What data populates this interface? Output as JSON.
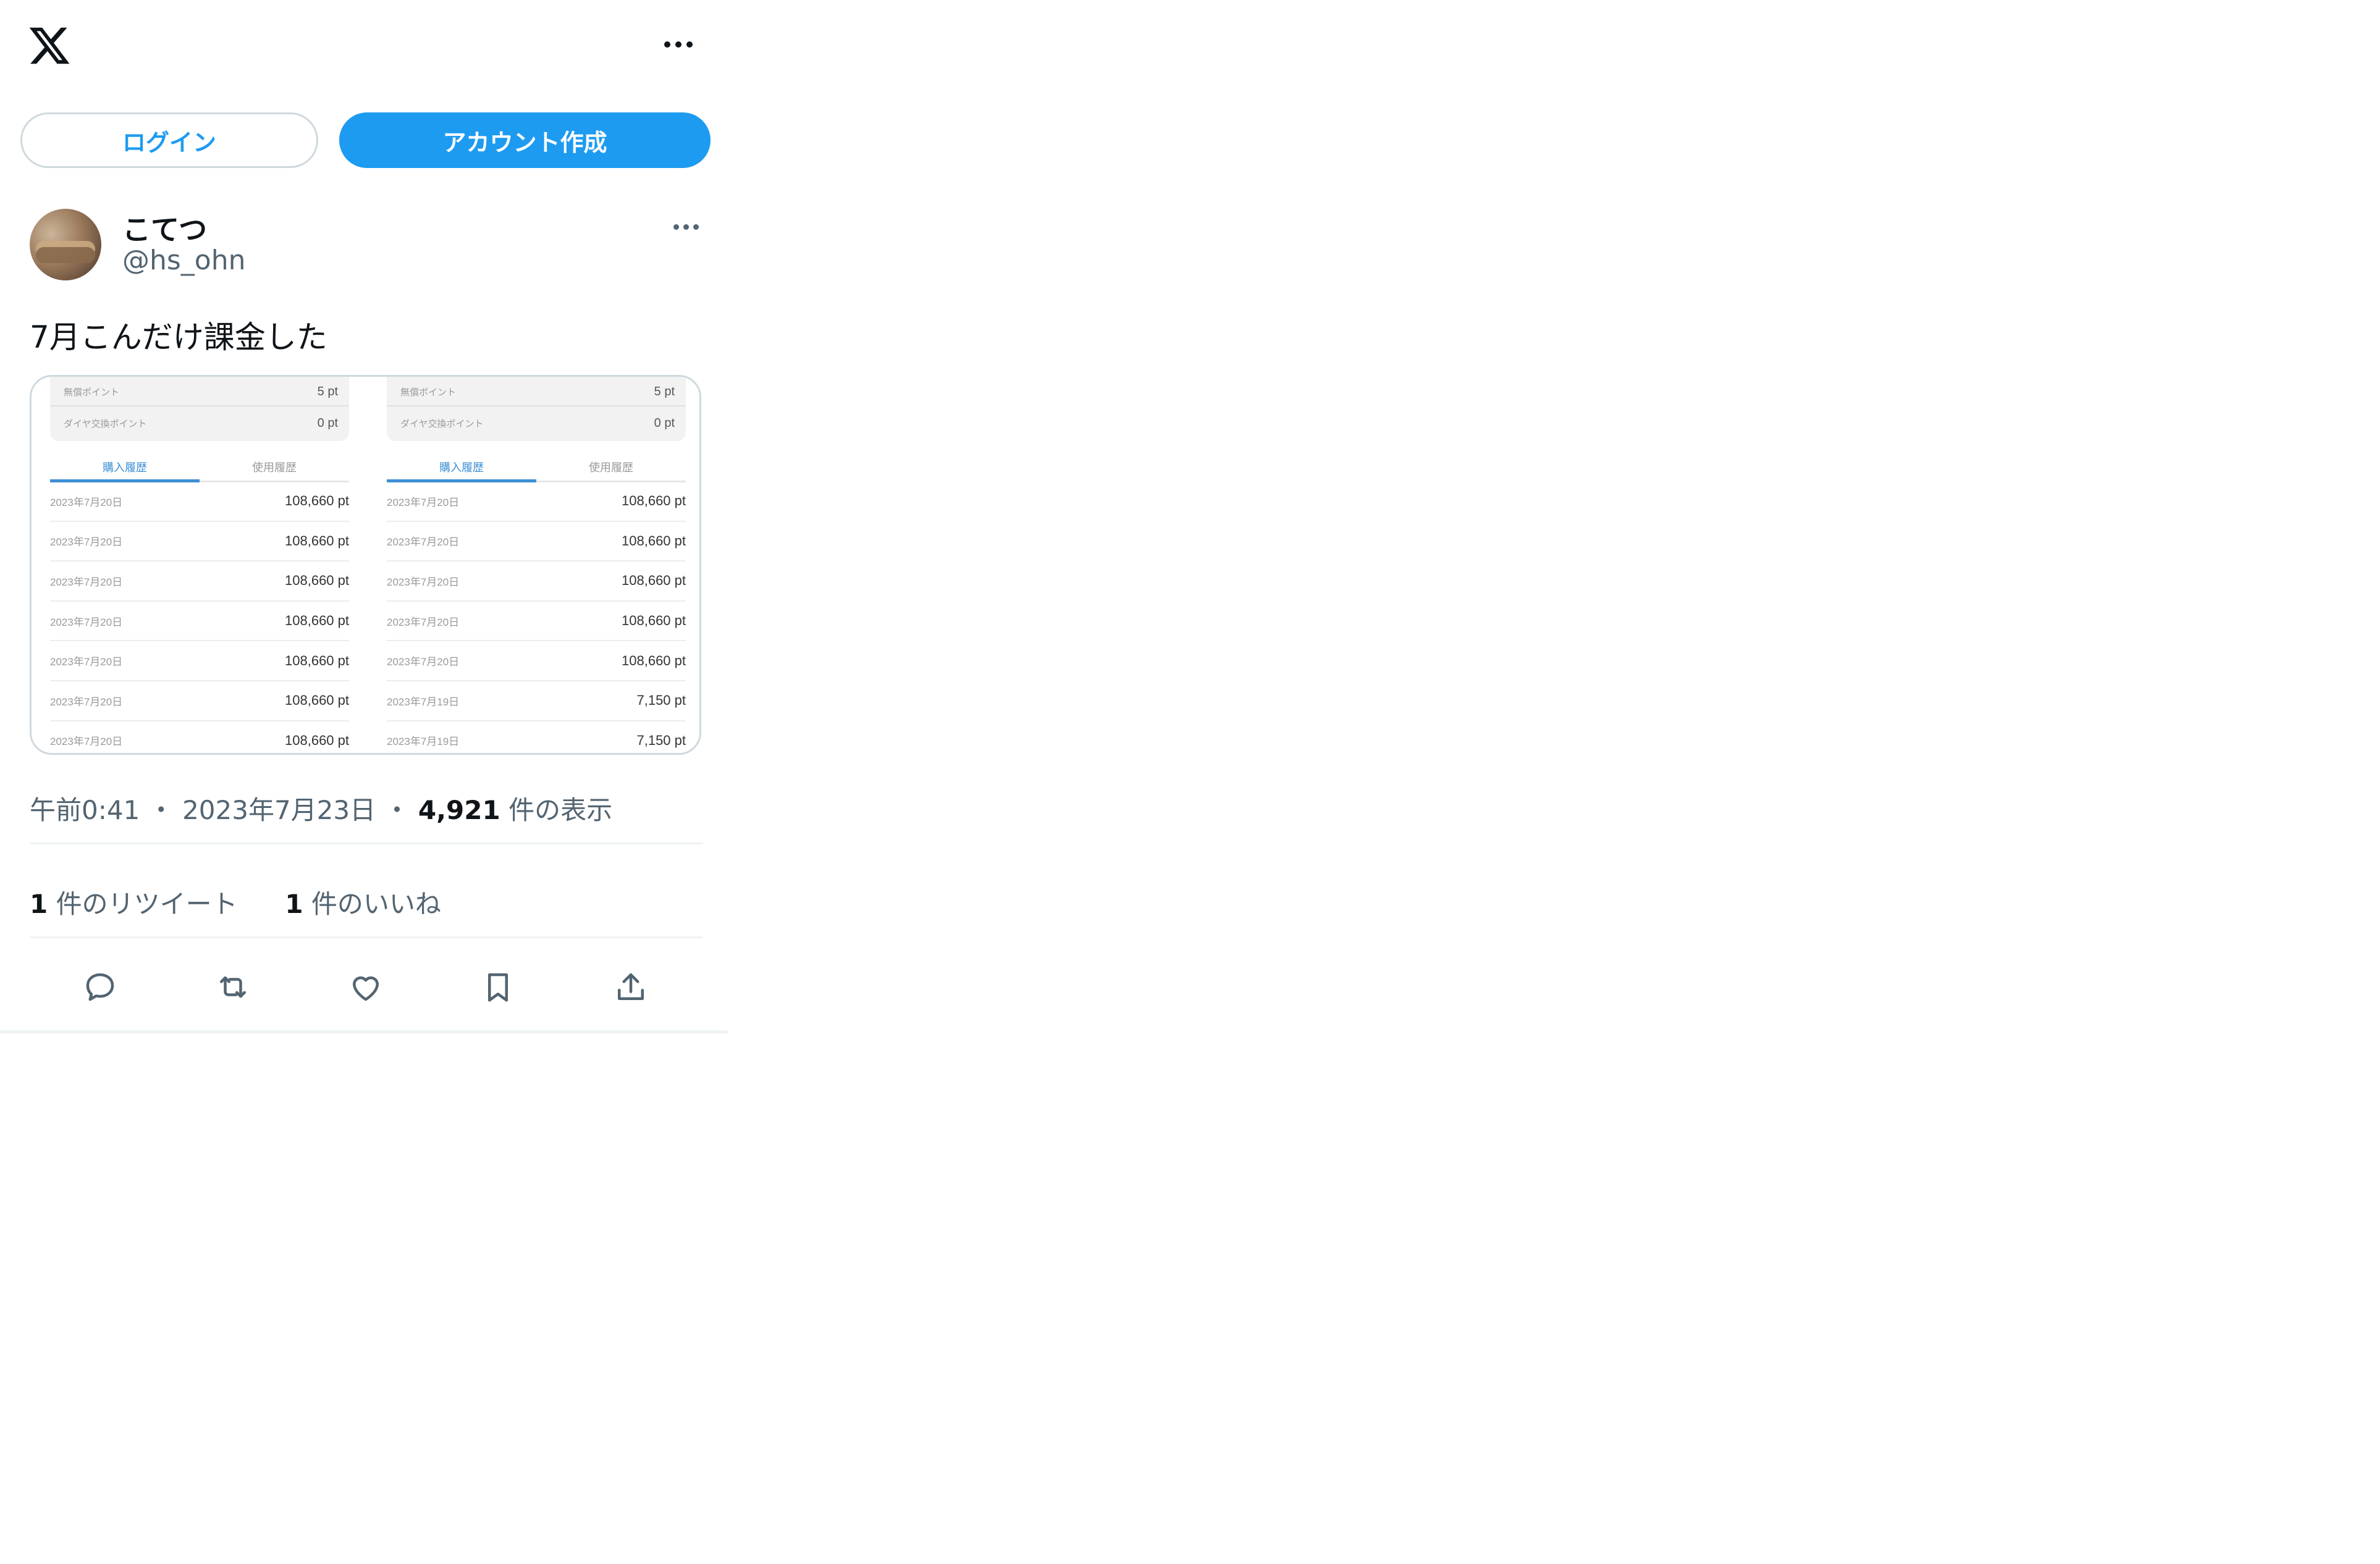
{
  "header": {
    "logo": "x-logo-icon",
    "more": "more-horizontal-icon"
  },
  "auth": {
    "login_label": "ログイン",
    "signup_label": "アカウント作成"
  },
  "author": {
    "name": "こてつ",
    "handle": "@hs_ohn"
  },
  "post": {
    "text": "7月こんだけ課金した"
  },
  "media": {
    "panels": [
      {
        "points": [
          {
            "label": "無償ポイント",
            "value": "5 pt"
          },
          {
            "label": "ダイヤ交換ポイント",
            "value": "0 pt"
          }
        ],
        "tabs": {
          "active": "購入履歴",
          "inactive": "使用履歴"
        },
        "rows": [
          {
            "date": "2023年7月20日",
            "amount": "108,660 pt"
          },
          {
            "date": "2023年7月20日",
            "amount": "108,660 pt"
          },
          {
            "date": "2023年7月20日",
            "amount": "108,660 pt"
          },
          {
            "date": "2023年7月20日",
            "amount": "108,660 pt"
          },
          {
            "date": "2023年7月20日",
            "amount": "108,660 pt"
          },
          {
            "date": "2023年7月20日",
            "amount": "108,660 pt"
          },
          {
            "date": "2023年7月20日",
            "amount": "108,660 pt"
          }
        ]
      },
      {
        "points": [
          {
            "label": "無償ポイント",
            "value": "5 pt"
          },
          {
            "label": "ダイヤ交換ポイント",
            "value": "0 pt"
          }
        ],
        "tabs": {
          "active": "購入履歴",
          "inactive": "使用履歴"
        },
        "rows": [
          {
            "date": "2023年7月20日",
            "amount": "108,660 pt"
          },
          {
            "date": "2023年7月20日",
            "amount": "108,660 pt"
          },
          {
            "date": "2023年7月20日",
            "amount": "108,660 pt"
          },
          {
            "date": "2023年7月20日",
            "amount": "108,660 pt"
          },
          {
            "date": "2023年7月20日",
            "amount": "108,660 pt"
          },
          {
            "date": "2023年7月19日",
            "amount": "7,150 pt"
          },
          {
            "date": "2023年7月19日",
            "amount": "7,150 pt"
          }
        ]
      }
    ]
  },
  "meta": {
    "time": "午前0:41",
    "sep": "・",
    "date": "2023年7月23日",
    "views_count": "4,921",
    "views_label": "件の表示"
  },
  "stats": {
    "retweets_count": "1",
    "retweets_label": "件のリツイート",
    "likes_count": "1",
    "likes_label": "件のいいね"
  },
  "actions": [
    "reply-icon",
    "retweet-icon",
    "like-icon",
    "bookmark-icon",
    "share-icon"
  ]
}
